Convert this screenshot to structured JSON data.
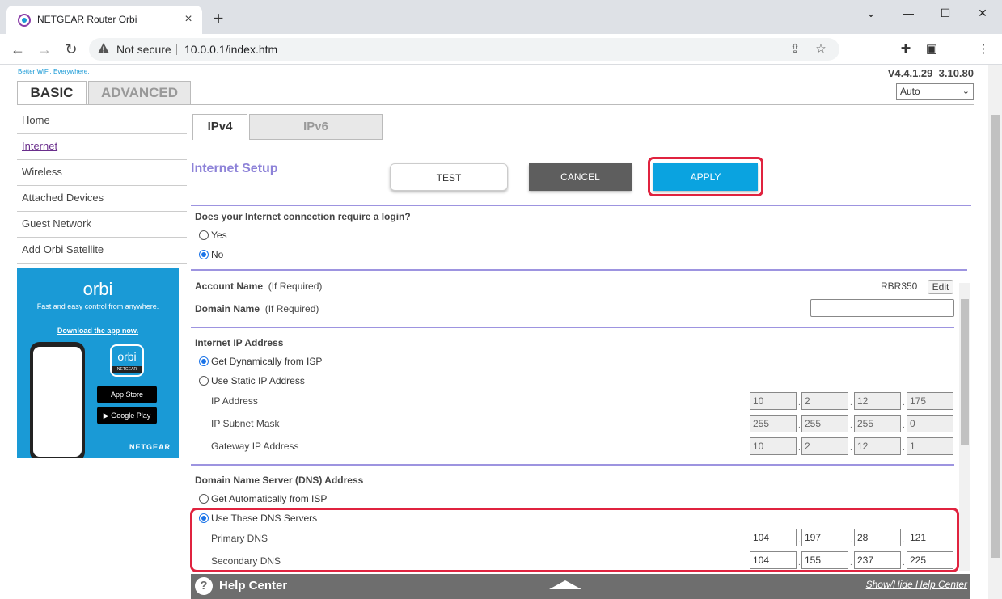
{
  "browser": {
    "tab_title": "NETGEAR Router Orbi",
    "new_tab": "+",
    "not_secure": "Not secure",
    "url": "10.0.0.1/index.htm"
  },
  "header": {
    "tagline": "Better WiFi. Everywhere.",
    "tab_basic": "BASIC",
    "tab_advanced": "ADVANCED",
    "version": "V4.4.1.29_3.10.80",
    "language_selected": "Auto"
  },
  "sidebar": {
    "items": [
      {
        "label": "Home"
      },
      {
        "label": "Internet"
      },
      {
        "label": "Wireless"
      },
      {
        "label": "Attached Devices"
      },
      {
        "label": "Guest Network"
      },
      {
        "label": "Add Orbi Satellite"
      }
    ]
  },
  "ad": {
    "logo": "orbi",
    "text": "Fast and easy control from anywhere.",
    "link": "Download the app now.",
    "icon_text": "orbi",
    "icon_sub": "NETGEAR",
    "app_store": "App Store",
    "google_play": "Google Play",
    "brand": "NETGEAR"
  },
  "subtabs": {
    "ipv4": "IPv4",
    "ipv6": "IPv6"
  },
  "main": {
    "title": "Internet Setup",
    "test": "TEST",
    "cancel": "CANCEL",
    "apply": "APPLY",
    "login_question": "Does your Internet connection require a login?",
    "yes": "Yes",
    "no": "No",
    "account_name": "Account Name",
    "if_required": "(If Required)",
    "account_value": "RBR350",
    "edit": "Edit",
    "domain_name": "Domain Name",
    "ip_section": "Internet IP Address",
    "get_dynamic": "Get Dynamically from ISP",
    "use_static": "Use Static IP Address",
    "ip_address": "IP Address",
    "ip_values": [
      "10",
      "2",
      "12",
      "175"
    ],
    "subnet_mask": "IP Subnet Mask",
    "subnet_values": [
      "255",
      "255",
      "255",
      "0"
    ],
    "gateway": "Gateway IP Address",
    "gateway_values": [
      "10",
      "2",
      "12",
      "1"
    ],
    "dns_section": "Domain Name Server (DNS) Address",
    "get_auto": "Get Automatically from ISP",
    "use_these": "Use These DNS Servers",
    "primary_dns": "Primary DNS",
    "primary_values": [
      "104",
      "197",
      "28",
      "121"
    ],
    "secondary_dns": "Secondary DNS",
    "secondary_values": [
      "104",
      "155",
      "237",
      "225"
    ]
  },
  "help": {
    "title": "Help Center",
    "toggle": "Show/Hide Help Center"
  }
}
